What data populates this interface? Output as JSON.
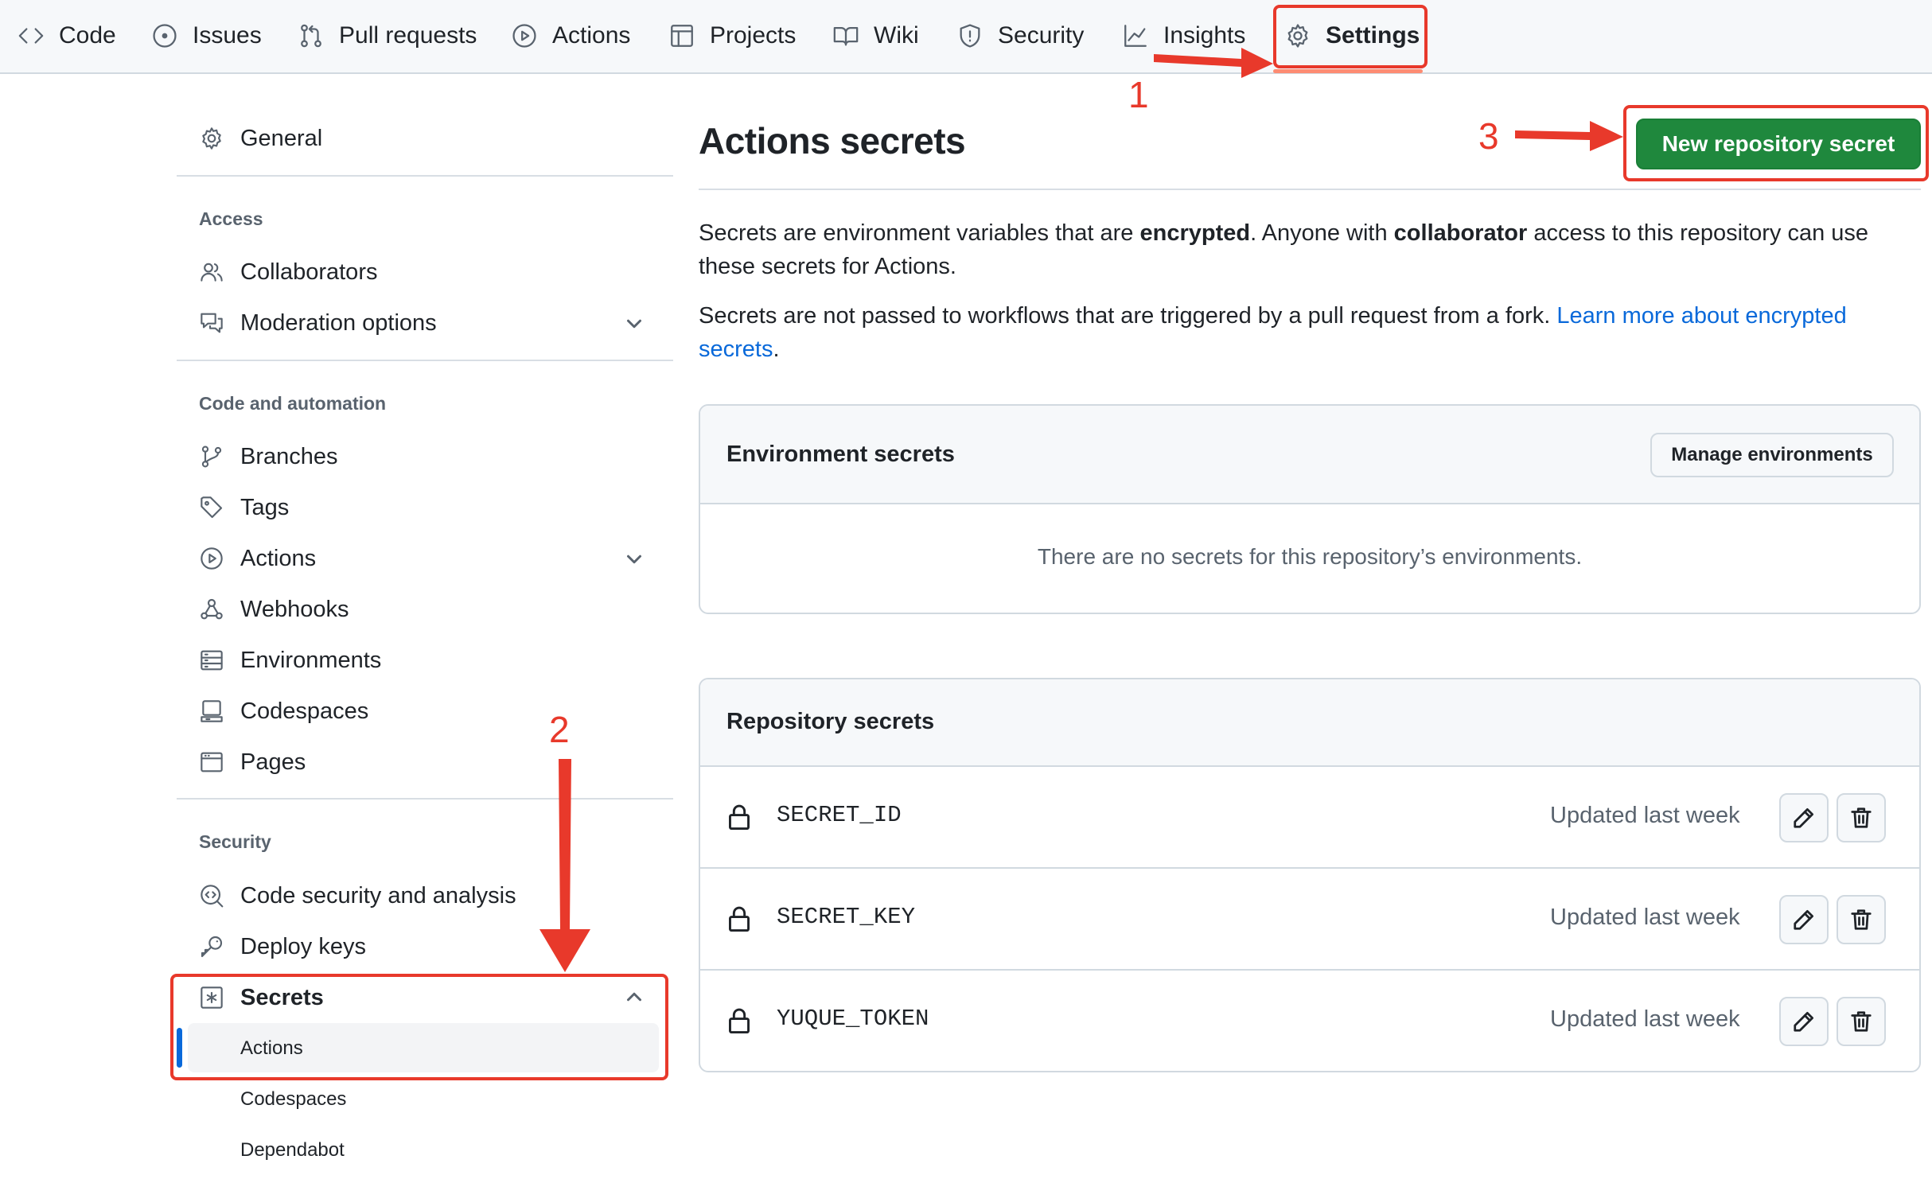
{
  "nav": {
    "tabs": [
      {
        "label": "Code",
        "icon": "code-icon"
      },
      {
        "label": "Issues",
        "icon": "issue-opened-icon"
      },
      {
        "label": "Pull requests",
        "icon": "git-pull-request-icon"
      },
      {
        "label": "Actions",
        "icon": "play-icon"
      },
      {
        "label": "Projects",
        "icon": "table-icon"
      },
      {
        "label": "Wiki",
        "icon": "book-icon"
      },
      {
        "label": "Security",
        "icon": "shield-icon"
      },
      {
        "label": "Insights",
        "icon": "graph-icon"
      },
      {
        "label": "Settings",
        "icon": "gear-icon",
        "selected": true
      }
    ]
  },
  "sidebar": {
    "general": "General",
    "sections": {
      "access": "Access",
      "code_automation": "Code and automation",
      "security": "Security"
    },
    "items": {
      "collaborators": "Collaborators",
      "moderation": "Moderation options",
      "branches": "Branches",
      "tags": "Tags",
      "actions": "Actions",
      "webhooks": "Webhooks",
      "environments": "Environments",
      "codespaces": "Codespaces",
      "pages": "Pages",
      "code_security": "Code security and analysis",
      "deploy_keys": "Deploy keys",
      "secrets": "Secrets"
    },
    "secrets_sub": [
      "Actions",
      "Codespaces",
      "Dependabot"
    ]
  },
  "main": {
    "title": "Actions secrets",
    "new_button": "New repository secret",
    "para1": {
      "t1": "Secrets are environment variables that are ",
      "b1": "encrypted",
      "t2": ". Anyone with ",
      "b2": "collaborator",
      "t3": " access to this repository can use these secrets for Actions."
    },
    "para2": {
      "t1": "Secrets are not passed to workflows that are triggered by a pull request from a fork. ",
      "link": "Learn more about encrypted secrets",
      "t2": "."
    },
    "env_secrets": {
      "title": "Environment secrets",
      "manage_button": "Manage environments",
      "empty": "There are no secrets for this repository’s environments."
    },
    "repo_secrets": {
      "title": "Repository secrets",
      "rows": [
        {
          "name": "SECRET_ID",
          "updated": "Updated last week"
        },
        {
          "name": "SECRET_KEY",
          "updated": "Updated last week"
        },
        {
          "name": "YUQUE_TOKEN",
          "updated": "Updated last week"
        }
      ]
    }
  },
  "annotations": {
    "step1": "1",
    "step2": "2",
    "step3": "3",
    "color": "#e8392b"
  },
  "colors": {
    "accent_green": "#1f883d",
    "link_blue": "#0969da",
    "selected_underline": "#fd8c73",
    "active_bar": "#0969da"
  }
}
